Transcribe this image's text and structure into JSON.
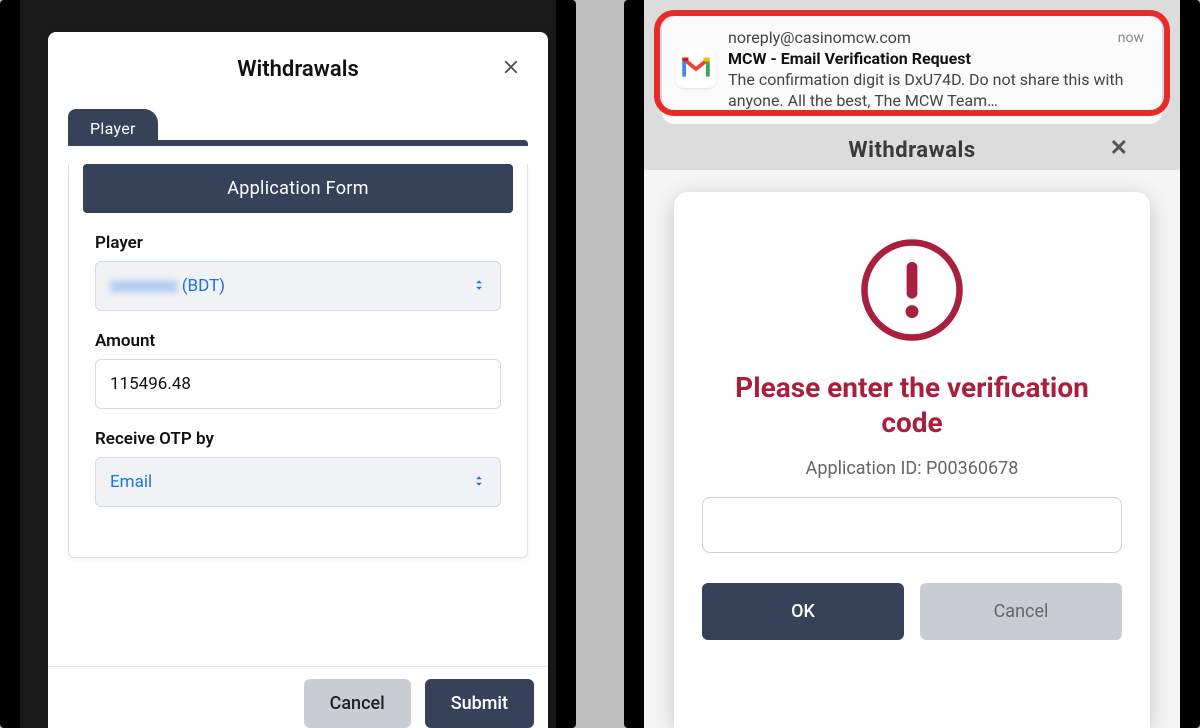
{
  "left": {
    "title": "Withdrawals",
    "tab": "Player",
    "panel_header": "Application Form",
    "fields": {
      "player_label": "Player",
      "player_value_suffix": "(BDT)",
      "amount_label": "Amount",
      "amount_value": "115496.48",
      "otp_label": "Receive OTP by",
      "otp_value": "Email"
    },
    "buttons": {
      "cancel": "Cancel",
      "submit": "Submit"
    }
  },
  "right": {
    "bg_title": "Withdrawals",
    "notification": {
      "sender": "noreply@casinomcw.com",
      "subject": "MCW - Email Verification Request",
      "body": "The confirmation digit is DxU74D. Do not share this with anyone. All the best, The MCW Team…",
      "time": "now"
    },
    "modal": {
      "heading": "Please enter the verification code",
      "app_id_label": "Application ID: P00360678"
    },
    "buttons": {
      "ok": "OK",
      "cancel": "Cancel"
    }
  }
}
